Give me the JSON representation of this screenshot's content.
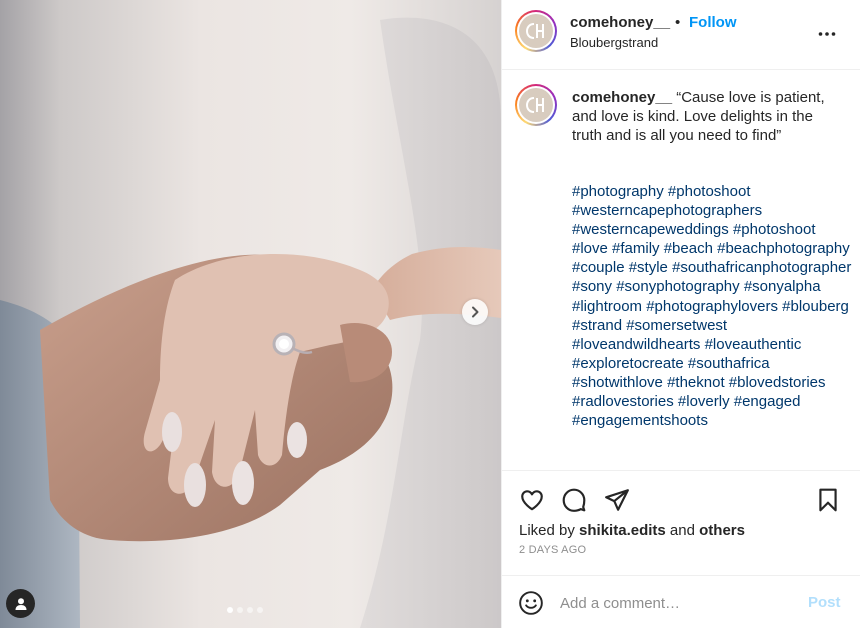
{
  "post": {
    "username": "comehoney__",
    "bullet": "•",
    "follow_label": "Follow",
    "location": "Bloubergstrand",
    "avatar_monogram": "CH"
  },
  "caption": {
    "username": "comehoney__",
    "text": "“Cause love is patient, and love is kind. Love delights in the truth and is all you need to find”",
    "hashtags": [
      "#photography",
      "#photoshoot",
      "#westerncapephotographers",
      "#westerncapeweddings",
      "#photoshoot",
      "#love",
      "#family",
      "#beach",
      "#beachphotography",
      "#couple",
      "#style",
      "#southafricanphotographer",
      "#sony",
      "#sonyphotography",
      "#sonyalpha",
      "#lightroom",
      "#photographylovers",
      "#blouberg",
      "#strand",
      "#somersetwest",
      "#loveandwildhearts",
      "#loveauthentic",
      "#exploretocreate",
      "#southafrica",
      "#shotwithlove",
      "#theknot",
      "#blovedstories",
      "#radlovestories",
      "#loverly",
      "#engaged",
      "#engagementshoots"
    ]
  },
  "likes": {
    "prefix": "Liked by",
    "user": "shikita.edits",
    "joiner": "and",
    "others": "others"
  },
  "date": "2 DAYS AGO",
  "comment": {
    "placeholder": "Add a comment…",
    "post_label": "Post"
  },
  "carousel": {
    "total": 4,
    "active_index": 0
  },
  "icons": {
    "more": "more-horizontal-icon",
    "like": "heart-icon",
    "comment": "comment-icon",
    "share": "share-icon",
    "save": "bookmark-icon",
    "emoji": "emoji-icon",
    "next": "chevron-right-icon",
    "tagged": "user-tag-icon"
  },
  "colors": {
    "link": "#0095f6",
    "hashtag": "#00376b",
    "post_disabled": "#b2dffc",
    "meta": "#8e8e8e"
  }
}
